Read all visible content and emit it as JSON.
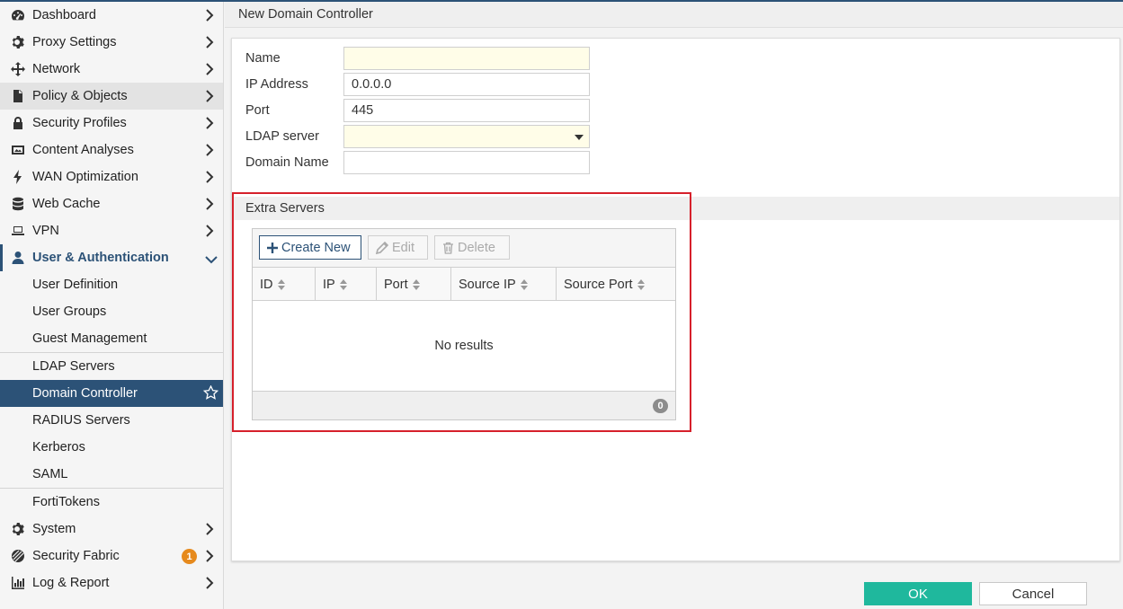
{
  "sidebar": {
    "items": [
      {
        "label": "Dashboard",
        "icon": "dashboard-icon"
      },
      {
        "label": "Proxy Settings",
        "icon": "gear-icon"
      },
      {
        "label": "Network",
        "icon": "move-arrows-icon"
      },
      {
        "label": "Policy & Objects",
        "icon": "document-icon"
      },
      {
        "label": "Security Profiles",
        "icon": "lock-icon"
      },
      {
        "label": "Content Analyses",
        "icon": "image-icon"
      },
      {
        "label": "WAN Optimization",
        "icon": "bolt-icon"
      },
      {
        "label": "Web Cache",
        "icon": "database-icon"
      },
      {
        "label": "VPN",
        "icon": "laptop-icon"
      },
      {
        "label": "User & Authentication",
        "icon": "user-icon"
      }
    ],
    "sub_items": [
      {
        "label": "User Definition"
      },
      {
        "label": "User Groups"
      },
      {
        "label": "Guest Management"
      },
      {
        "label": "LDAP Servers"
      },
      {
        "label": "Domain Controller"
      },
      {
        "label": "RADIUS Servers"
      },
      {
        "label": "Kerberos"
      },
      {
        "label": "SAML"
      },
      {
        "label": "FortiTokens"
      }
    ],
    "bottom_items": [
      {
        "label": "System",
        "icon": "gear-icon"
      },
      {
        "label": "Security Fabric",
        "icon": "fabric-icon",
        "badge": "1"
      },
      {
        "label": "Log & Report",
        "icon": "bar-chart-icon"
      }
    ]
  },
  "header": {
    "title": "New Domain Controller"
  },
  "form": {
    "name_label": "Name",
    "name_value": "",
    "ip_label": "IP Address",
    "ip_value": "0.0.0.0",
    "port_label": "Port",
    "port_value": "445",
    "ldap_label": "LDAP server",
    "ldap_value": "",
    "domain_label": "Domain Name",
    "domain_value": ""
  },
  "extra_servers": {
    "title": "Extra Servers",
    "toolbar": {
      "create": "Create New",
      "edit": "Edit",
      "delete": "Delete"
    },
    "columns": [
      "ID",
      "IP",
      "Port",
      "Source IP",
      "Source Port"
    ],
    "empty_text": "No results",
    "count": "0"
  },
  "footer": {
    "ok": "OK",
    "cancel": "Cancel"
  },
  "colors": {
    "accent": "#2c5277",
    "ok": "#1fb89d",
    "highlight": "#d6202b",
    "badge": "#e68a1d"
  }
}
